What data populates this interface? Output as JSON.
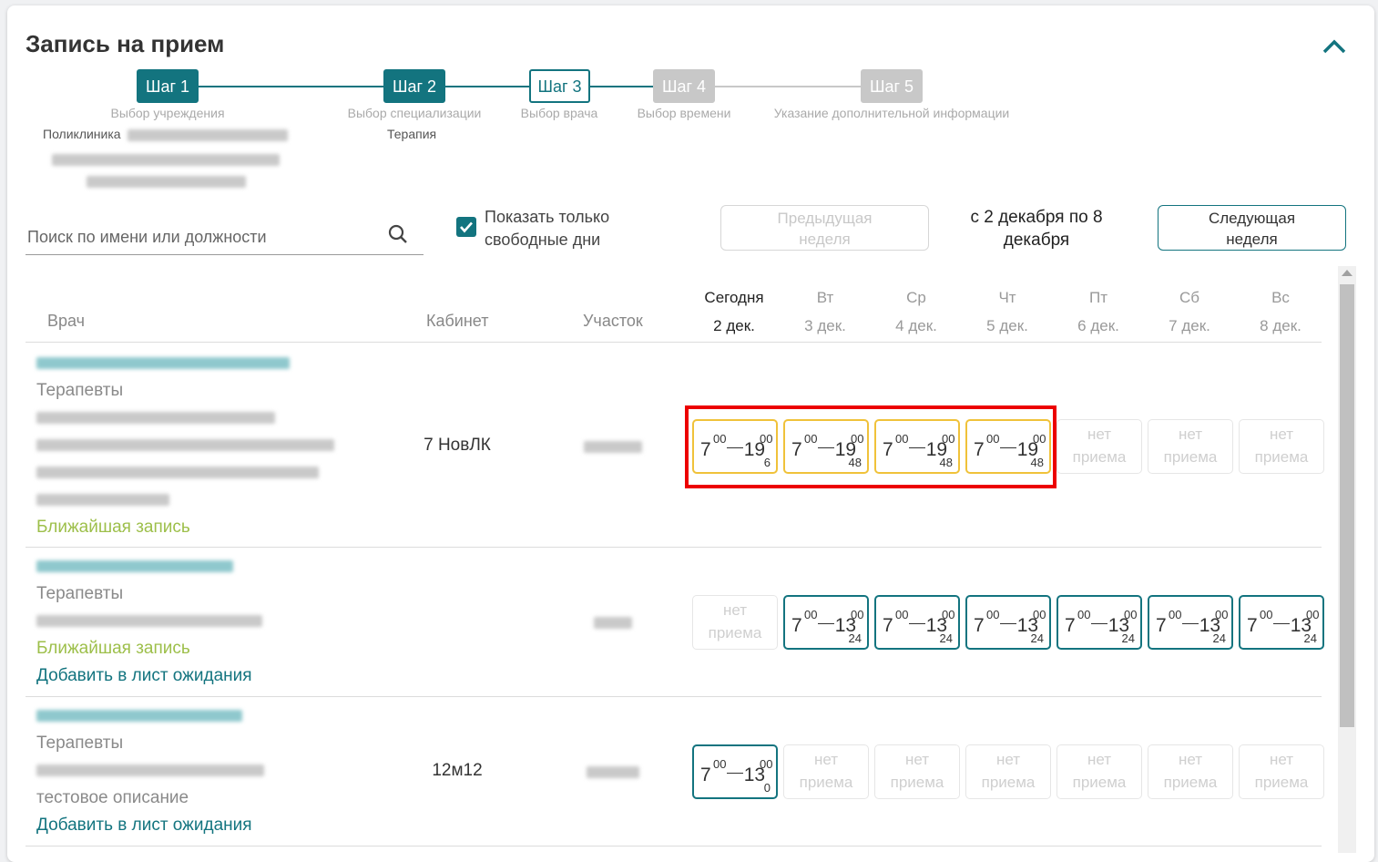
{
  "title": "Запись на прием",
  "stepper": {
    "steps": [
      {
        "label": "Шаг 1",
        "caption": "Выбор учреждения",
        "state": "done"
      },
      {
        "label": "Шаг 2",
        "caption": "Выбор специализации",
        "state": "done"
      },
      {
        "label": "Шаг 3",
        "caption": "Выбор врача",
        "state": "current"
      },
      {
        "label": "Шаг 4",
        "caption": "Выбор времени",
        "state": "future"
      },
      {
        "label": "Шаг 5",
        "caption": "Указание дополнительной информации",
        "state": "future"
      }
    ],
    "step1_value": "Поликлиника",
    "step2_value": "Терапия"
  },
  "search": {
    "placeholder": "Поиск по имени или должности"
  },
  "filter": {
    "label_line1": "Показать только",
    "label_line2": "свободные дни",
    "checked": true
  },
  "week_nav": {
    "prev_line1": "Предыдущая",
    "prev_line2": "неделя",
    "range_line1": "с 2 декабря по 8",
    "range_line2": "декабря",
    "next_line1": "Следующая",
    "next_line2": "неделя"
  },
  "table": {
    "col_doctor": "Врач",
    "col_cabinet": "Кабинет",
    "col_uchastok": "Участок",
    "days": [
      {
        "name": "Сегодня",
        "date": "2 дек."
      },
      {
        "name": "Вт",
        "date": "3 дек."
      },
      {
        "name": "Ср",
        "date": "4 дек."
      },
      {
        "name": "Чт",
        "date": "5 дек."
      },
      {
        "name": "Пт",
        "date": "6 дек."
      },
      {
        "name": "Сб",
        "date": "7 дек."
      },
      {
        "name": "Вс",
        "date": "8 дек."
      }
    ],
    "no_reception_line1": "нет",
    "no_reception_line2": "приема",
    "rows": [
      {
        "specialty": "Терапевты",
        "nearest": "Ближайшая запись",
        "cabinet": "7 НовЛК",
        "slots": [
          {
            "start_h": "7",
            "start_m": "00",
            "end_h": "19",
            "end_m": "00",
            "count": "6",
            "style": "yellow"
          },
          {
            "start_h": "7",
            "start_m": "00",
            "end_h": "19",
            "end_m": "00",
            "count": "48",
            "style": "yellow"
          },
          {
            "start_h": "7",
            "start_m": "00",
            "end_h": "19",
            "end_m": "00",
            "count": "48",
            "style": "yellow"
          },
          {
            "start_h": "7",
            "start_m": "00",
            "end_h": "19",
            "end_m": "00",
            "count": "48",
            "style": "yellow"
          },
          null,
          null,
          null
        ]
      },
      {
        "specialty": "Терапевты",
        "nearest": "Ближайшая запись",
        "waitlist": "Добавить в лист ожидания",
        "cabinet": "",
        "slots": [
          null,
          {
            "start_h": "7",
            "start_m": "00",
            "end_h": "13",
            "end_m": "00",
            "count": "24",
            "style": "teal"
          },
          {
            "start_h": "7",
            "start_m": "00",
            "end_h": "13",
            "end_m": "00",
            "count": "24",
            "style": "teal"
          },
          {
            "start_h": "7",
            "start_m": "00",
            "end_h": "13",
            "end_m": "00",
            "count": "24",
            "style": "teal"
          },
          {
            "start_h": "7",
            "start_m": "00",
            "end_h": "13",
            "end_m": "00",
            "count": "24",
            "style": "teal"
          },
          {
            "start_h": "7",
            "start_m": "00",
            "end_h": "13",
            "end_m": "00",
            "count": "24",
            "style": "teal"
          },
          {
            "start_h": "7",
            "start_m": "00",
            "end_h": "13",
            "end_m": "00",
            "count": "24",
            "style": "teal"
          }
        ]
      },
      {
        "specialty": "Терапевты",
        "description": "тестовое описание",
        "waitlist": "Добавить в лист ожидания",
        "cabinet": "12м12",
        "slots": [
          {
            "start_h": "7",
            "start_m": "00",
            "end_h": "13",
            "end_m": "00",
            "count": "0",
            "style": "teal"
          },
          null,
          null,
          null,
          null,
          null,
          null
        ]
      }
    ]
  },
  "colors": {
    "accent": "#13747f",
    "nearest": "#9dbf4a",
    "slot_highlight": "#f0c23a",
    "annotation": "#ec0000"
  }
}
